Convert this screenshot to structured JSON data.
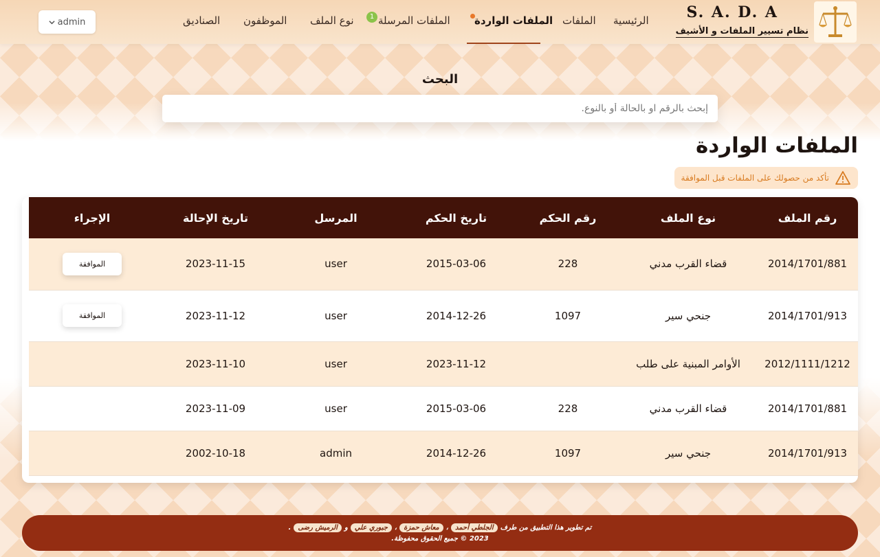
{
  "brand": {
    "title": "S. A. D. A",
    "subtitle": "نظام تسيير الملفات و الأشيف"
  },
  "nav": {
    "home": "الرئيسية",
    "files": "الملفات",
    "incoming": "الملفات الواردة",
    "sent": "الملفات المرسلة",
    "sent_badge": "1",
    "file_type": "نوع الملف",
    "employees": "الموظفون",
    "boxes": "الصناديق",
    "active": "incoming"
  },
  "user_menu": {
    "selected": "admin"
  },
  "search": {
    "label": "البحث",
    "placeholder": "إبحث بالرقم او بالحالة أو بالنوع."
  },
  "page_title": "الملفات الواردة",
  "alert": {
    "text": "تأكد من حصولك على الملفات قبل الموافقة",
    "color": "#d87b21"
  },
  "table": {
    "headers": {
      "file_number": "رقم الملف",
      "file_type": "نوع الملف",
      "ruling_number": "رقم الحكم",
      "ruling_date": "تاريخ الحكم",
      "sender": "المرسل",
      "transfer_date": "تاريخ الإحالة",
      "action": "الإجراء"
    },
    "rows": [
      {
        "file_number": "2014/1701/881",
        "file_type": "قضاء القرب مدني",
        "ruling_number": "228",
        "ruling_date": "2015-03-06",
        "sender": "user",
        "transfer_date": "2023-11-15",
        "action": "الموافقة"
      },
      {
        "file_number": "2014/1701/913",
        "file_type": "جنحي سير",
        "ruling_number": "1097",
        "ruling_date": "2014-12-26",
        "sender": "user",
        "transfer_date": "2023-11-12",
        "action": "الموافقة"
      },
      {
        "file_number": "2012/1111/1212",
        "file_type": "الأوامر المبنية على طلب",
        "ruling_number": "",
        "ruling_date": "2023-11-12",
        "sender": "user",
        "transfer_date": "2023-11-10",
        "action": ""
      },
      {
        "file_number": "2014/1701/881",
        "file_type": "قضاء القرب مدني",
        "ruling_number": "228",
        "ruling_date": "2015-03-06",
        "sender": "user",
        "transfer_date": "2023-11-09",
        "action": ""
      },
      {
        "file_number": "2014/1701/913",
        "file_type": "جنحي سير",
        "ruling_number": "1097",
        "ruling_date": "2014-12-26",
        "sender": "admin",
        "transfer_date": "2002-10-18",
        "action": ""
      }
    ]
  },
  "footer": {
    "prefix": "تم تطوير هذا التطبيق من طرف",
    "dev1": "الجلطي أحمد",
    "sep1": "،",
    "dev2": "معاش حمزة",
    "sep2": "،",
    "dev3": "جبوري علي",
    "and": "و",
    "dev4": "الرميش رضى",
    "end": ".",
    "copyright": "2023 © جميع الحقوق محفوظة."
  },
  "colors": {
    "header_bg": "#f6d7b6",
    "table_header": "#421309",
    "row_alt": "#fdebd6",
    "footer_bg": "#942d12",
    "nav_active_underline": "#a0441b",
    "badge_green": "#8bc34a",
    "badge_orange": "#e8782a"
  },
  "icons": {
    "logo": "scales-of-justice-icon",
    "alert": "warning-triangle-icon",
    "dropdown": "chevron-down-icon"
  }
}
